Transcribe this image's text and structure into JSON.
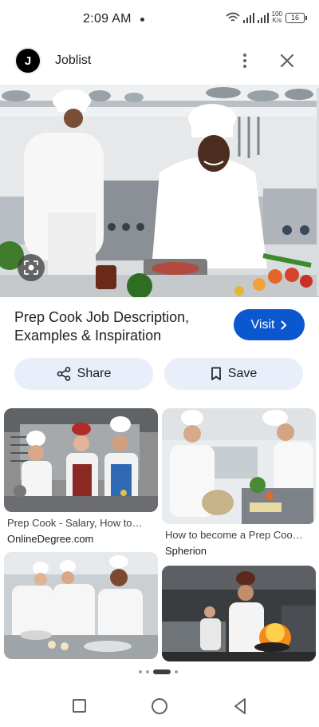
{
  "status_bar": {
    "time": "2:09 AM",
    "speed_value": "100",
    "speed_unit": "K/s",
    "battery": "16"
  },
  "header": {
    "logo_letter": "J",
    "title": "Joblist"
  },
  "result": {
    "title": "Prep Cook Job Description, Examples & Inspiration",
    "visit_label": "Visit"
  },
  "actions": {
    "share_label": "Share",
    "save_label": "Save"
  },
  "related": [
    {
      "caption": "Prep Cook - Salary, How to…",
      "source": "OnlineDegree.com"
    },
    {
      "caption": "How to become a Prep Coo…",
      "source": "Spherion"
    },
    {
      "caption": "",
      "source": ""
    },
    {
      "caption": "",
      "source": ""
    }
  ],
  "icons": {
    "more": "more-vert-icon",
    "close": "close-icon",
    "lens": "lens-icon",
    "share": "share-icon",
    "save": "bookmark-icon",
    "visit": "chevron-right-icon"
  },
  "colors": {
    "accent": "#0b57d0",
    "pill": "#e8eefa"
  }
}
